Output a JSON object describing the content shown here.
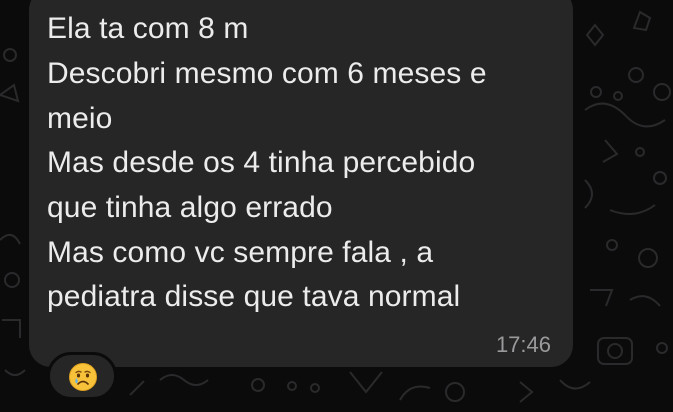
{
  "message": {
    "lines": [
      "Ela ta com 8 m",
      "Descobri mesmo com 6 meses e",
      "meio",
      "Mas desde os 4 tinha percebido",
      "que tinha algo errado",
      "Mas como vc sempre fala , a",
      "pediatra disse que tava normal"
    ],
    "time": "17:46"
  },
  "reaction": {
    "icon": "crying-face-icon"
  },
  "colors": {
    "background": "#0b0b0c",
    "bubble": "#262627",
    "text": "#ececec",
    "timestamp": "#9a9a9c"
  }
}
